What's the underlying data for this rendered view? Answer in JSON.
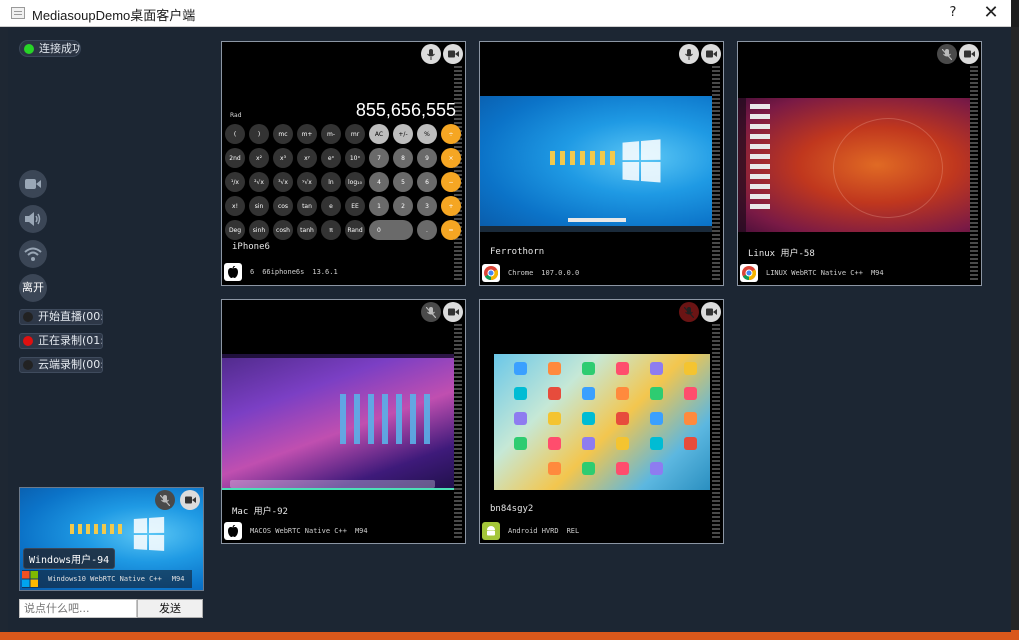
{
  "window": {
    "title": "MediasoupDemo桌面客户端",
    "help_label": "?",
    "close_label": "✕"
  },
  "status": {
    "connection": "连接成功",
    "connection_color": "#27d427"
  },
  "controls": {
    "leave_label": "离开"
  },
  "recording": [
    {
      "label": "开始直播(00:",
      "dot_color": "#222222"
    },
    {
      "label": "正在录制(01:",
      "dot_color": "#e01010"
    },
    {
      "label": "云端录制(00:",
      "dot_color": "#222222"
    }
  ],
  "peers": [
    {
      "name": "iPhone6",
      "os_icon": "apple-icon",
      "browser": "6",
      "device": "66iphone6s",
      "version": "13.6.1"
    },
    {
      "name": "Ferrothorn",
      "os_icon": "chrome-icon",
      "browser": "Chrome",
      "version": "107.0.0.0"
    },
    {
      "name": "Linux 用户-58",
      "os_icon": "chrome-icon",
      "browser": "LINUX WebRTC Native C++",
      "version": "M94"
    },
    {
      "name": "Mac 用户-92",
      "os_icon": "apple-icon",
      "browser": "MACOS WebRTC Native C++",
      "version": "M94"
    },
    {
      "name": "bn84sgy2",
      "os_icon": "android-icon",
      "browser": "Android HVRD",
      "version": "REL"
    }
  ],
  "calculator": {
    "display": "855,656,555",
    "mode": "Rad",
    "rows": [
      [
        "(",
        ")",
        "mc",
        "m+",
        "m-",
        "mr",
        "AC",
        "+/-",
        "%",
        "÷"
      ],
      [
        "2nd",
        "x²",
        "x³",
        "xʸ",
        "eˣ",
        "10ˣ",
        "7",
        "8",
        "9",
        "×"
      ],
      [
        "¹/x",
        "²√x",
        "³√x",
        "ʸ√x",
        "ln",
        "log₁₀",
        "4",
        "5",
        "6",
        "−"
      ],
      [
        "x!",
        "sin",
        "cos",
        "tan",
        "e",
        "EE",
        "1",
        "2",
        "3",
        "+"
      ],
      [
        "Deg",
        "sinh",
        "cosh",
        "tanh",
        "π",
        "Rand",
        "0",
        "",
        ".",
        "="
      ]
    ]
  },
  "self": {
    "name": "Windows用户-94",
    "browser": "Windows10 WebRTC Native C++",
    "version": "M94"
  },
  "chat": {
    "placeholder": "说点什么吧...",
    "send_label": "发送"
  }
}
